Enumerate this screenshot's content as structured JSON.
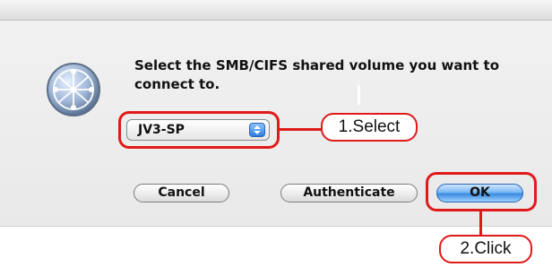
{
  "dialog": {
    "prompt": "Select the SMB/CIFS shared volume you want to connect to.",
    "volume_popup": {
      "selected": "JV3-SP"
    },
    "buttons": {
      "cancel": "Cancel",
      "authenticate": "Authenticate",
      "ok": "OK"
    }
  },
  "annotations": {
    "step1": "1.Select",
    "step2": "2.Click"
  },
  "colors": {
    "highlight": "#e01a1a",
    "primary_button": "#3b8ae0"
  },
  "icons": {
    "dialog_icon": "network-globe-icon",
    "popup_arrows": "up-down-arrows-icon"
  }
}
